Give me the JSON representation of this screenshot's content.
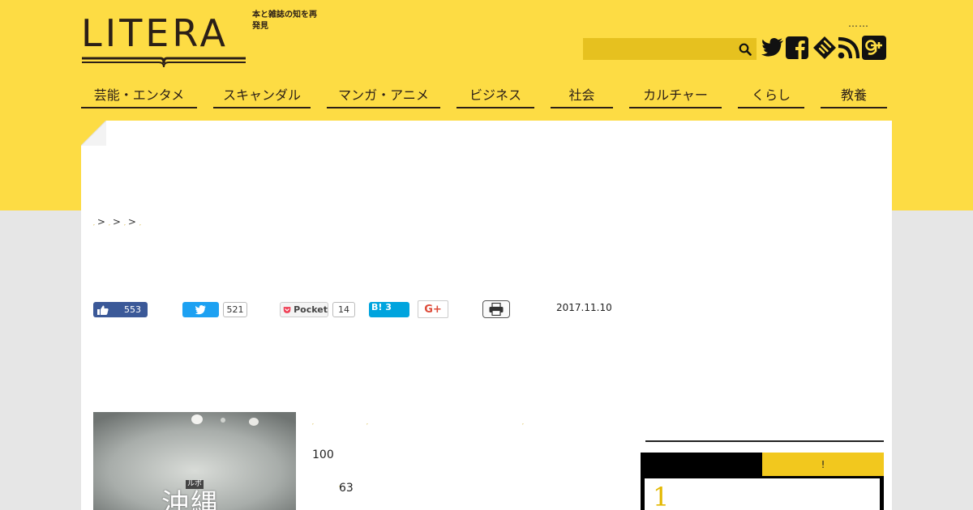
{
  "header": {
    "logo_text": "LITERA",
    "tagline": "本と雑誌の知を再発見",
    "dots": "……",
    "search_placeholder": ""
  },
  "social_icons": [
    "twitter-icon",
    "facebook-icon",
    "feedly-icon",
    "rss-icon",
    "google-plus-icon"
  ],
  "nav": {
    "items": [
      {
        "label": "芸能・エンタメ"
      },
      {
        "label": "スキャンダル"
      },
      {
        "label": "マンガ・アニメ"
      },
      {
        "label": "ビジネス"
      },
      {
        "label": "社会"
      },
      {
        "label": "カルチャー"
      },
      {
        "label": "くらし"
      },
      {
        "label": "教養"
      }
    ]
  },
  "breadcrumb": {
    "separator": ">"
  },
  "share": {
    "facebook_count": "553",
    "twitter_count": "521",
    "pocket_label": "Pocket",
    "pocket_count": "14",
    "hatena_label": "B! 3",
    "gplus_label": "G+"
  },
  "article": {
    "date": "2017.11.10",
    "body_num_1": "100",
    "body_num_2": "63",
    "book_label_small": "ルポ",
    "book_title": "沖縄"
  },
  "sidebar": {
    "tab_b_label": "!",
    "rank_first": "1"
  },
  "colors": {
    "brand_yellow": "#fddc44",
    "search_bg": "#e6c11f",
    "accent_gold": "#f2c81e",
    "dark_brown": "#2b1f17"
  }
}
